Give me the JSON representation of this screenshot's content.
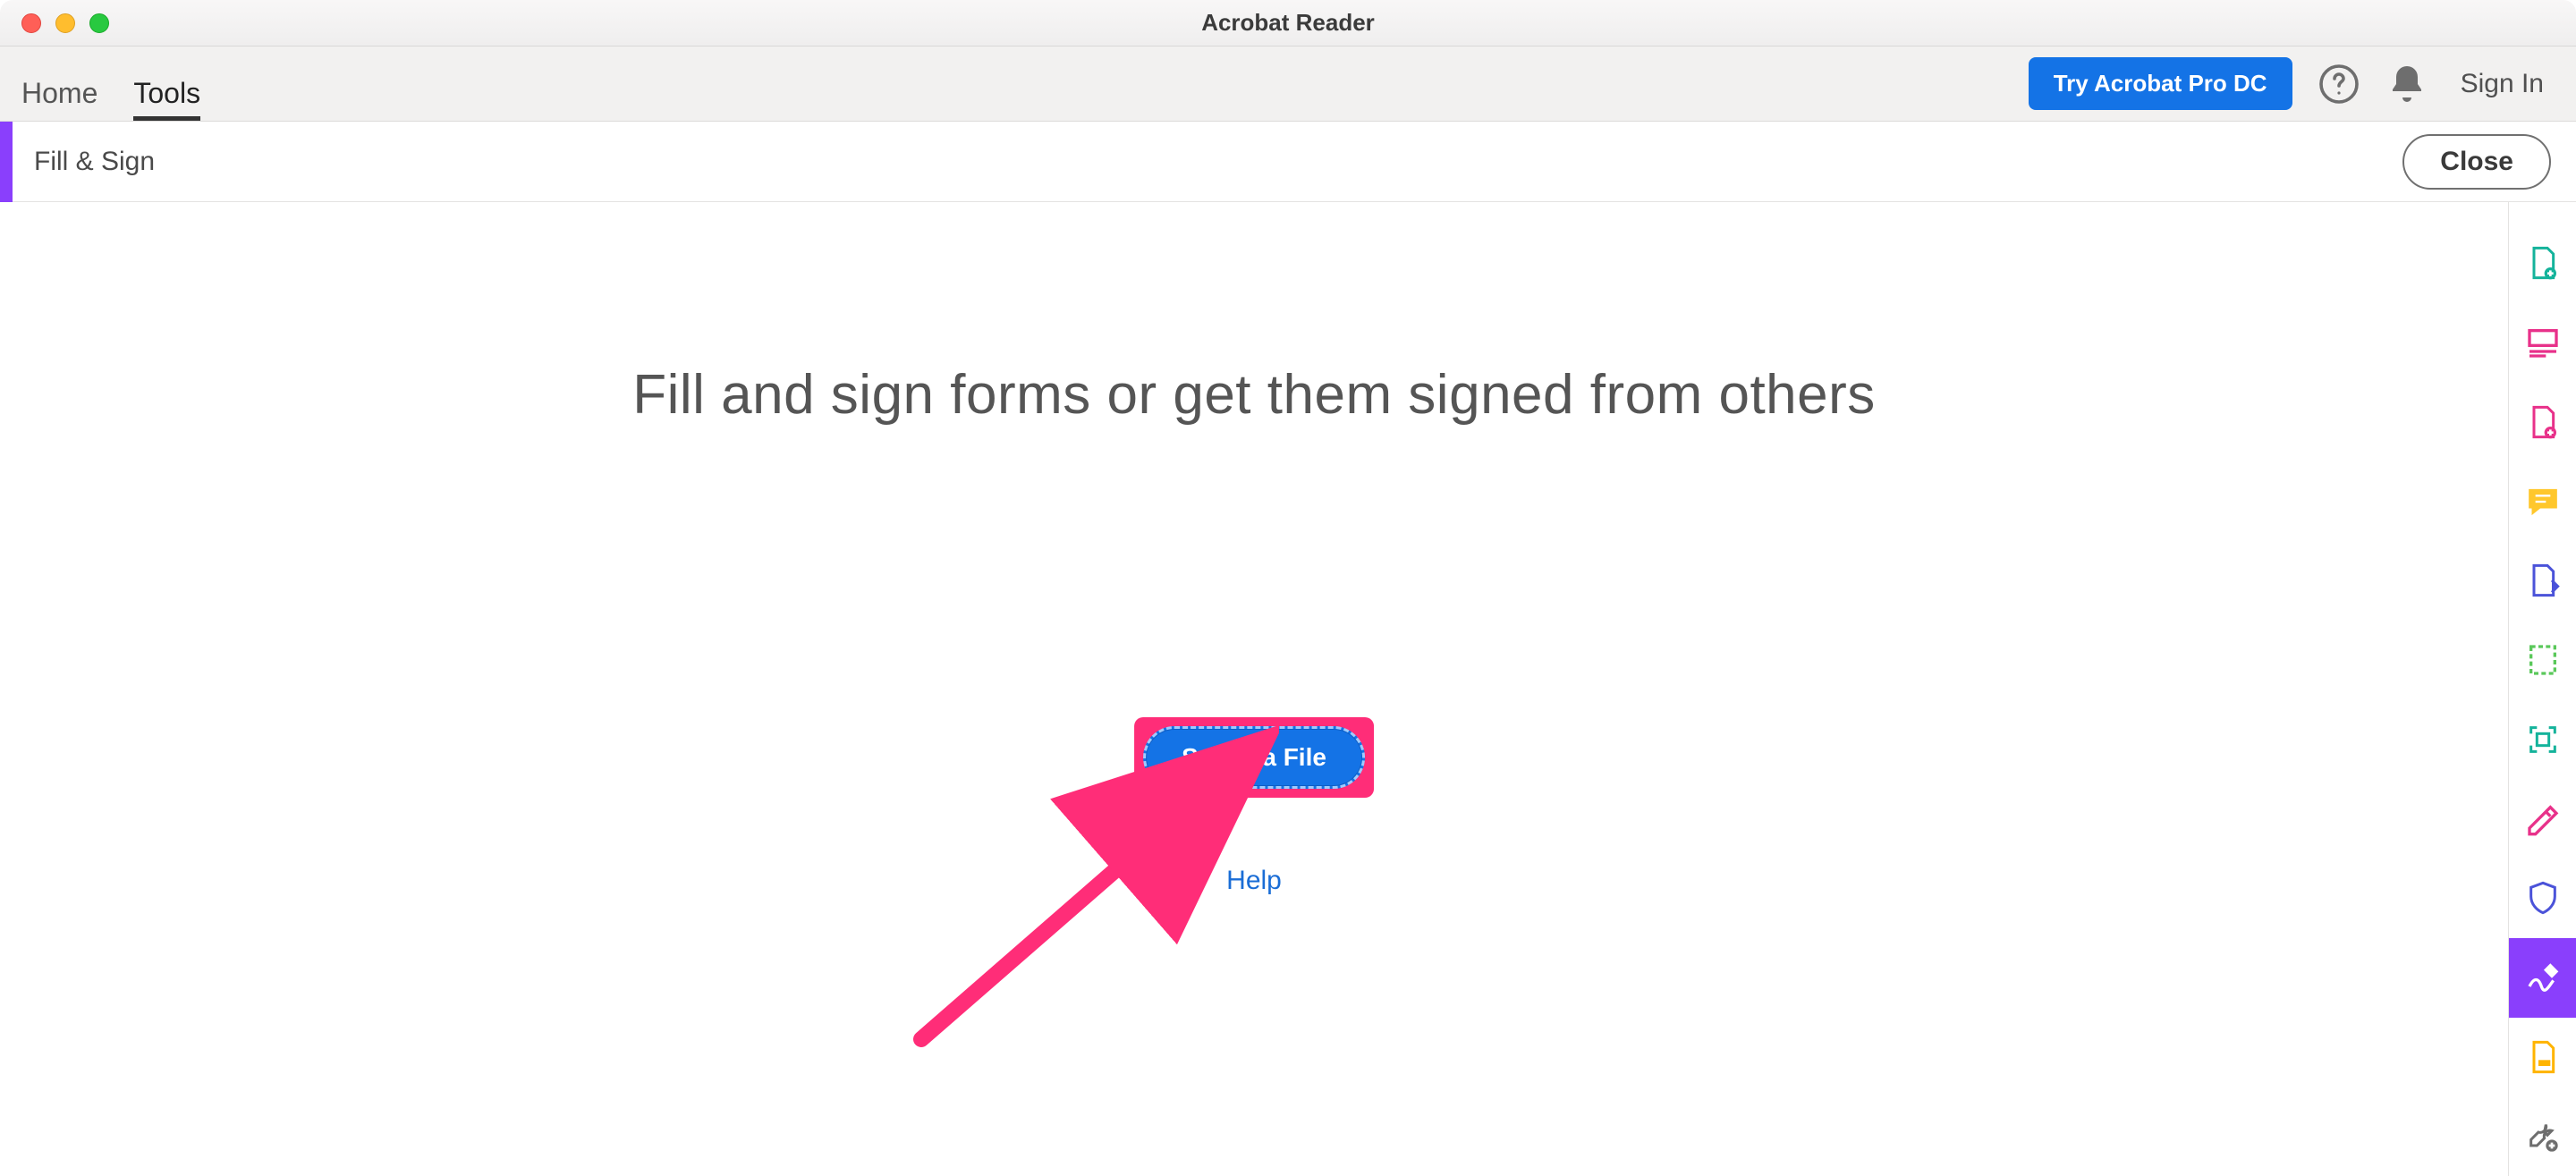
{
  "window": {
    "title": "Acrobat Reader"
  },
  "topbar": {
    "tabs": {
      "home": "Home",
      "tools": "Tools"
    },
    "try_label": "Try Acrobat Pro DC",
    "signin_label": "Sign In"
  },
  "toolsub": {
    "name": "Fill & Sign",
    "close_label": "Close"
  },
  "main": {
    "heading": "Fill and sign forms or get them signed from others",
    "select_label": "Select a File",
    "help_label": "Help"
  },
  "rail_icons": [
    "create-pdf-icon",
    "combine-files-icon",
    "edit-pdf-icon",
    "comment-icon",
    "export-pdf-icon",
    "organize-pages-icon",
    "compress-pdf-icon",
    "redact-icon",
    "protect-icon",
    "fill-sign-icon",
    "stamp-icon",
    "more-tools-icon"
  ]
}
